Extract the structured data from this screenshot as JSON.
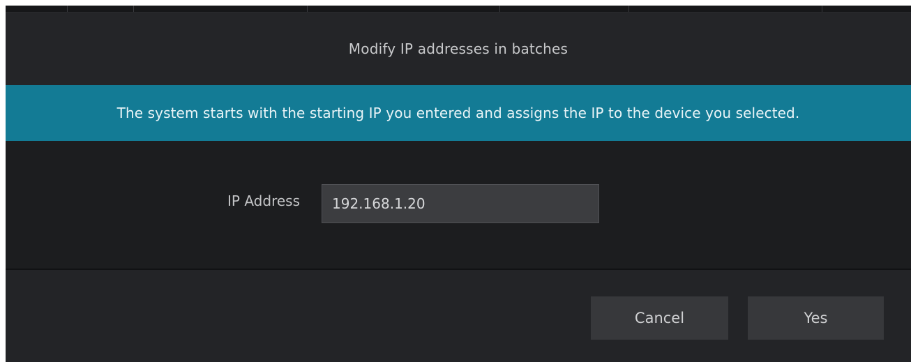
{
  "dialog": {
    "title": "Modify IP addresses in batches",
    "info_message": "The system starts with the starting IP you entered and assigns the IP to the device you selected."
  },
  "form": {
    "ip_address": {
      "label": "IP Address",
      "value": "192.168.1.20"
    }
  },
  "footer": {
    "cancel_label": "Cancel",
    "yes_label": "Yes"
  },
  "colors": {
    "banner": "#137b95",
    "dialog_background": "#1d1e20",
    "button": "#37383b"
  }
}
